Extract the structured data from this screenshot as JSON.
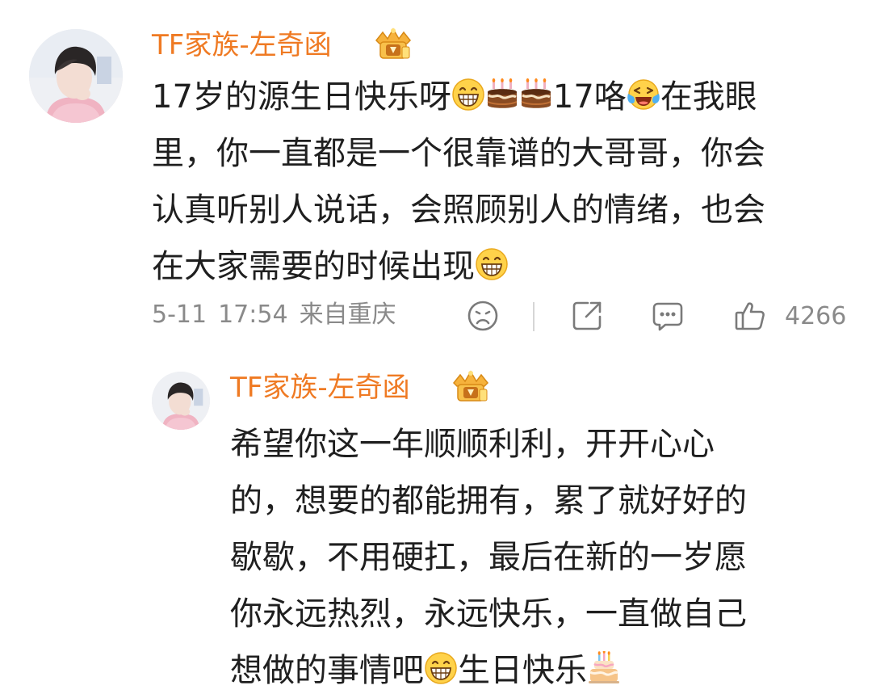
{
  "comment": {
    "username": "TF家族-左奇函",
    "badge_icon": "vip-crown-badge-icon",
    "text_lines": [
      [
        "17岁的源生日快乐呀",
        {
          "emoji": "grin"
        },
        {
          "emoji": "cake"
        },
        {
          "emoji": "cake"
        },
        "17咯",
        {
          "emoji": "laugh-cry"
        },
        "在我眼"
      ],
      [
        "里，你一直都是一个很靠谱的大哥哥，你会"
      ],
      [
        "认真听别人说话，会照顾别人的情绪，也会"
      ],
      [
        "在大家需要的时候出现",
        {
          "emoji": "grin"
        }
      ]
    ],
    "meta": {
      "date": "5-11",
      "time": "17:54",
      "location": "来自重庆"
    },
    "actions": {
      "dislike_icon": "dislike-face-icon",
      "share_icon": "share-icon",
      "comment_icon": "comment-icon",
      "like_icon": "thumbs-up-icon",
      "like_count": "4266"
    }
  },
  "reply": {
    "username": "TF家族-左奇函",
    "badge_icon": "vip-crown-badge-icon",
    "text_lines": [
      [
        "希望你这一年顺顺利利，开开心心"
      ],
      [
        "的，想要的都能拥有，累了就好好的"
      ],
      [
        "歇歇，不用硬扛，最后在新的一岁愿"
      ],
      [
        "你永远热烈，永远快乐，一直做自己"
      ],
      [
        "想做的事情吧",
        {
          "emoji": "grin"
        },
        "生日快乐",
        {
          "emoji": "birthday-cake"
        }
      ]
    ]
  },
  "colors": {
    "username": "#ef7a23",
    "text": "#1f1f1f",
    "meta": "#8a8a8a",
    "divider": "#d6d6d6"
  }
}
